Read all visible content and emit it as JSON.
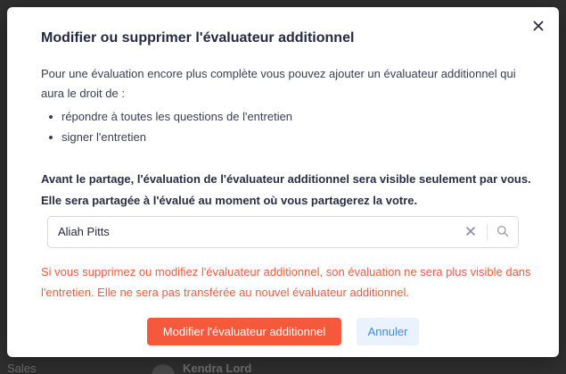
{
  "background": {
    "left_text": "Sales",
    "name": "Kendra Lord"
  },
  "modal": {
    "title": "Modifier ou supprimer l'évaluateur additionnel",
    "intro": "Pour une évaluation encore plus complète vous pouvez ajouter un évaluateur additionnel qui aura le droit de :",
    "bullets": [
      "répondre à toutes les questions de l'entretien",
      "signer l'entretien"
    ],
    "notice": "Avant le partage, l'évaluation de l'évaluateur additionnel sera visible seulement par vous. Elle sera partagée à l'évalué au moment où vous partagerez la votre.",
    "search": {
      "value": "Aliah Pitts"
    },
    "warning": "Si vous supprimez ou modifiez l'évaluateur additionnel, son évaluation ne sera plus visible dans l'entretien. Elle ne sera pas transférée au nouvel évaluateur additionnel.",
    "buttons": {
      "primary": "Modifier l'évaluateur additionnel",
      "secondary": "Annuler"
    }
  },
  "colors": {
    "primary": "#f4593c",
    "secondary_bg": "#e9f2fd",
    "secondary_text": "#3a8bea",
    "title": "#262942",
    "warning": "#f4593c"
  },
  "icons": {
    "close": "close-icon",
    "clear": "clear-icon",
    "search": "search-icon"
  }
}
